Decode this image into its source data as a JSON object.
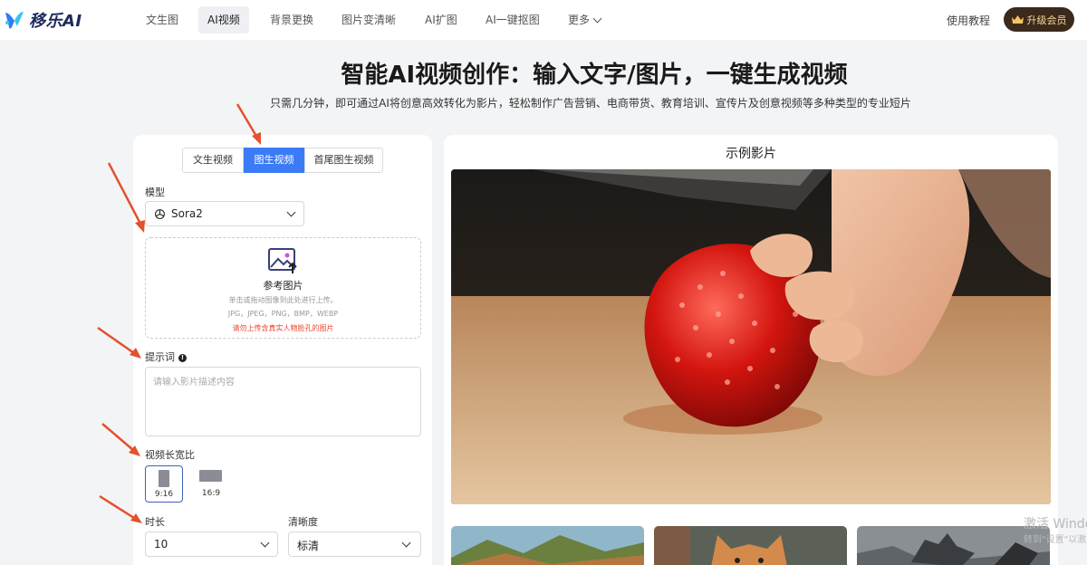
{
  "brand": {
    "name": "移乐AI"
  },
  "nav": {
    "items": [
      "文生图",
      "AI视频",
      "背景更换",
      "图片变清晰",
      "AI扩图",
      "AI一键抠图",
      "更多"
    ],
    "active": "AI视频",
    "help": "使用教程",
    "upgrade": "升级会员"
  },
  "hero": {
    "title": "智能AI视频创作：输入文字/图片，一键生成视频",
    "subtitle": "只需几分钟，即可通过AI将创意高效转化为影片，轻松制作广告营销、电商带货、教育培训、宣传片及创意视频等多种类型的专业短片"
  },
  "form": {
    "modes": [
      "文生视频",
      "图生视频",
      "首尾图生视频"
    ],
    "active_mode": "图生视频",
    "model_label": "模型",
    "model_value": "Sora2",
    "upload": {
      "title": "参考图片",
      "hint1": "单击或拖动图像到此处进行上传。",
      "hint2": "JPG，JPEG，PNG，BMP，WEBP",
      "warning": "请勿上传含真实人物脸孔的图片"
    },
    "prompt_label": "提示词",
    "prompt_placeholder": "请输入影片描述内容",
    "ratio_label": "视频长宽比",
    "ratios": [
      "9:16",
      "16:9"
    ],
    "active_ratio": "9:16",
    "duration_label": "时长",
    "duration_value": "10",
    "quality_label": "清晰度",
    "quality_value": "标清"
  },
  "examples": {
    "title": "示例影片"
  },
  "os_watermark": {
    "line1": "激活 Windo",
    "line2": "转到\"设置\"以激"
  },
  "colors": {
    "accent": "#3b7bf6",
    "warning": "#e8452c",
    "vip_bg": "#3b2a1c",
    "vip_text": "#f6d79a"
  }
}
